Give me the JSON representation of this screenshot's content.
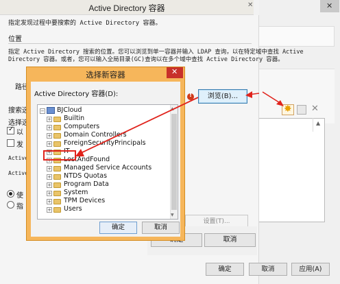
{
  "outer_window": {
    "title": "Active Directory 容器",
    "description": "指定发现过程中要搜索的 Active Directory 容器。",
    "location_label": "位置",
    "location_desc_1": "指定 Active Directory 搜索的位置。您可以浏览到单一容器并输入 LDAP 查询，以在特定域中查找 Active",
    "location_desc_2": "Directory 容器。或者，您可以输入全局目录(GC)查询以在多个域中查找 Active Directory 容器。",
    "path_label": "路径",
    "search_options_label": "搜索选",
    "search_label2": "选择选",
    "checkbox1_label": "以",
    "checkbox2_label": "发",
    "active_label1": "Active",
    "active_label2": "Active",
    "radio1_label": "使",
    "radio2_label": "指",
    "browse_button": "浏览(B)...",
    "settings_button": "设置(T)...",
    "ok_button": "确定",
    "cancel_button": "取消",
    "bottom_ok": "确定",
    "bottom_cancel": "取消",
    "bottom_apply": "应用(A)"
  },
  "dialog": {
    "title": "选择新容器",
    "label": "Active Directory 容器(D):",
    "root": "BJCloud",
    "items": [
      "Builtin",
      "Computers",
      "Domain Controllers",
      "ForeignSecurityPrincipals",
      "IT",
      "LostAndFound",
      "Managed Service Accounts",
      "NTDS Quotas",
      "Program Data",
      "System",
      "TPM Devices",
      "Users"
    ],
    "highlighted_item": "IT",
    "ok_button": "确定",
    "cancel_button": "取消"
  },
  "colors": {
    "dialog_frame": "#f6b65b",
    "close_button": "#c8302a",
    "annotation_red": "#e0231c",
    "browse_border": "#3c7fb1"
  }
}
